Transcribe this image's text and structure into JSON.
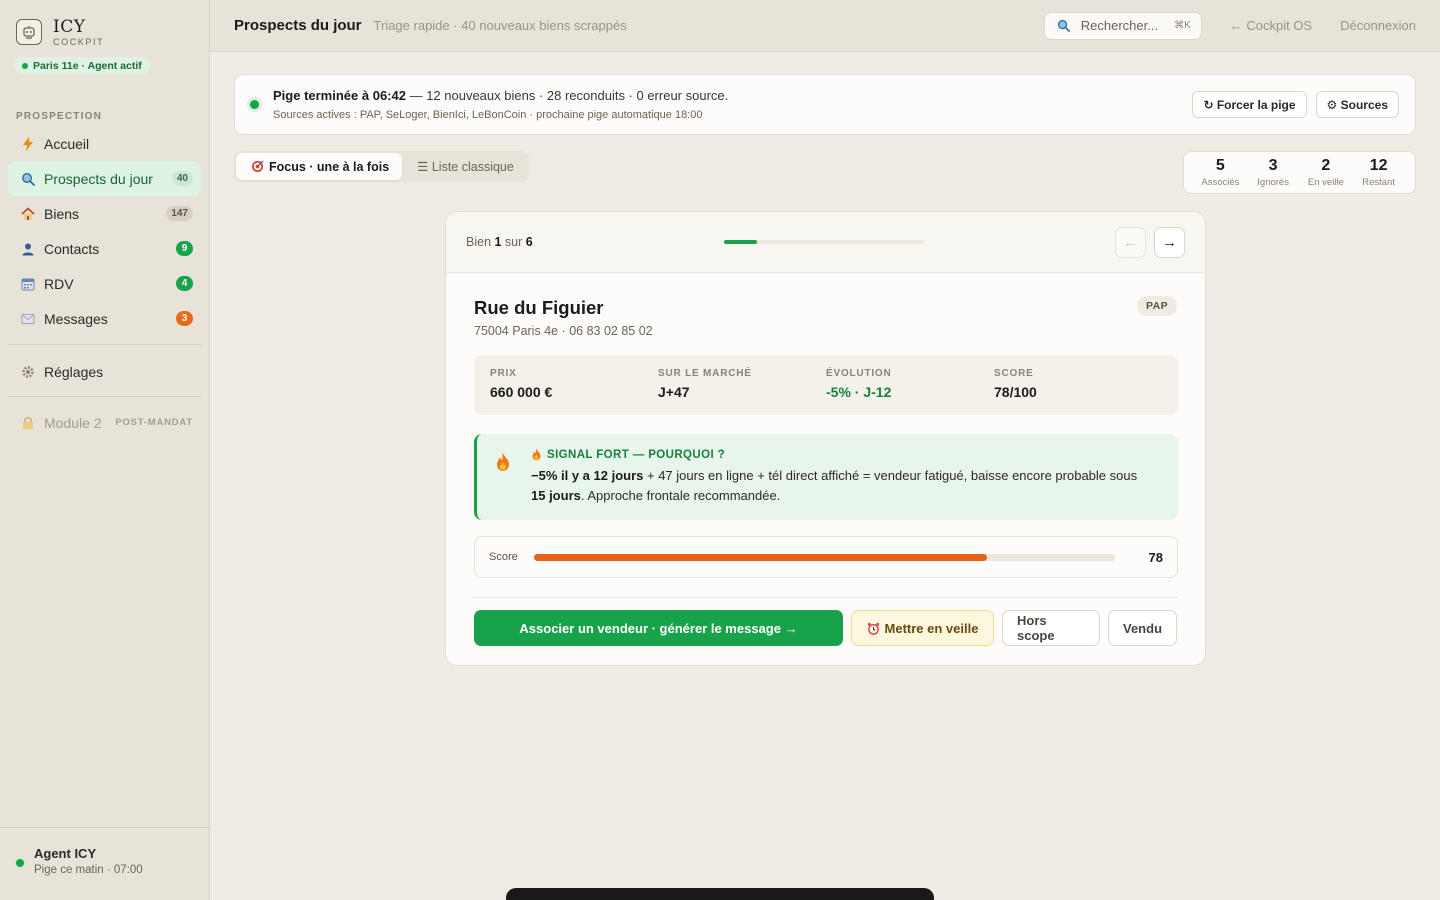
{
  "brand": {
    "name": "ICY",
    "sub": "COCKPIT",
    "agent_status": "Paris 11e · Agent actif"
  },
  "sidebar": {
    "section_label": "PROSPECTION",
    "items": [
      {
        "label": "Accueil",
        "badge": ""
      },
      {
        "label": "Prospects du jour",
        "badge": "40"
      },
      {
        "label": "Biens",
        "badge": "147"
      },
      {
        "label": "Contacts",
        "badge": "9"
      },
      {
        "label": "RDV",
        "badge": "4"
      },
      {
        "label": "Messages",
        "badge": "3"
      }
    ],
    "settings_label": "Réglages",
    "module_label": "Module 2",
    "module_tag": "POST-MANDAT",
    "footer": {
      "name": "Agent ICY",
      "sub": "Pige ce matin · 07:00"
    }
  },
  "topbar": {
    "title": "Prospects du jour",
    "subtitle": "Triage rapide · 40 nouveaux biens scrappés",
    "search_placeholder": "Rechercher...",
    "search_shortcut": "⌘K",
    "link_back": "← Cockpit OS",
    "link_logout": "Déconnexion"
  },
  "banner": {
    "strong": "Pige terminée à 06:42",
    "rest": " — 12 nouveaux biens · 28 reconduits · 0 erreur source.",
    "sources": "Sources actives : PAP, SeLoger, BienIci, LeBonCoin · prochaine pige automatique 18:00",
    "btn_force": "↻ Forcer la pige",
    "btn_sources": "⚙ Sources"
  },
  "tabs": {
    "focus": "Focus · une à la fois",
    "list": "☰ Liste classique"
  },
  "stats": [
    {
      "n": "5",
      "k": "Associés"
    },
    {
      "n": "3",
      "k": "Ignorés"
    },
    {
      "n": "2",
      "k": "En veille"
    },
    {
      "n": "12",
      "k": "Restant"
    }
  ],
  "card": {
    "count_prefix": "Bien ",
    "current": "1",
    "count_mid": " sur ",
    "total": "6",
    "progress": 0.1667,
    "prev": "←",
    "next": "→",
    "title": "Rue du Figuier",
    "subtitle": "75004 Paris 4e · 06 83 02 85 02",
    "source_tag": "PAP",
    "metrics": [
      {
        "k": "PRIX",
        "v": "660 000 €",
        "green": false
      },
      {
        "k": "SUR LE MARCHÉ",
        "v": "J+47",
        "green": false
      },
      {
        "k": "ÉVOLUTION",
        "v": "-5% · J-12",
        "green": true
      },
      {
        "k": "SCORE",
        "v": "78/100",
        "green": false
      }
    ],
    "signal": {
      "head": "SIGNAL FORT — POURQUOI ?",
      "b1": "−5% il y a 12 jours",
      "t1": " + 47 jours en ligne + tél direct affiché = vendeur fatigué, baisse encore probable sous ",
      "b2": "15 jours",
      "t2": ". Approche frontale recommandée."
    },
    "score_label": "Score",
    "score_value": "78",
    "score_fraction": 0.78,
    "actions": {
      "primary": "Associer un vendeur · générer le message →",
      "veille": "Mettre en veille",
      "hors_scope": "Hors scope",
      "vendu": "Vendu"
    }
  },
  "colors": {
    "accent": "#18a34a",
    "score": "#e5611a",
    "background": "#f0ece4"
  }
}
